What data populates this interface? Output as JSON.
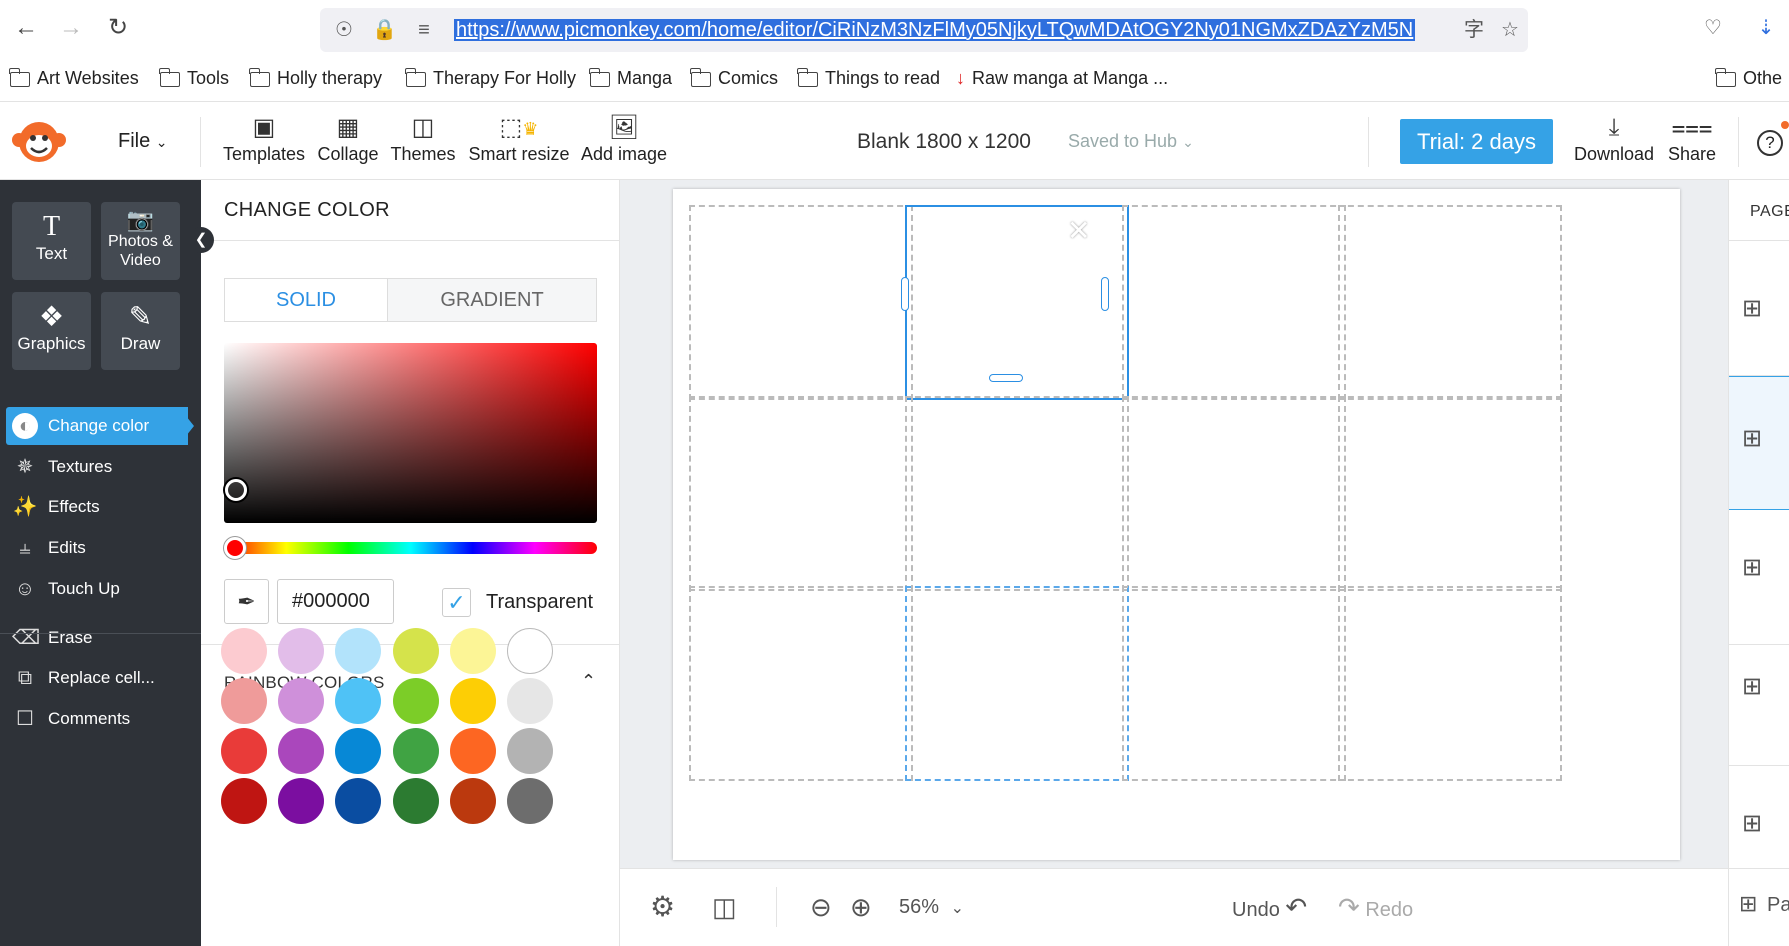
{
  "browser": {
    "url": "https://www.picmonkey.com/home/editor/CiRiNzM3NzFlMy05NjkyLTQwMDAtOGY2Ny01NGMxZDAzYzM5N",
    "bookmarks": [
      "Art Websites",
      "Tools",
      "Holly therapy",
      "Therapy For Holly",
      "Manga",
      "Comics",
      "Things to read",
      "Raw manga at Manga ...",
      "Othe"
    ]
  },
  "topbar": {
    "file_label": "File",
    "tools": [
      {
        "label": "Templates",
        "icon": "templates-icon"
      },
      {
        "label": "Collage",
        "icon": "collage-icon"
      },
      {
        "label": "Themes",
        "icon": "themes-icon"
      },
      {
        "label": "Smart resize",
        "icon": "smart-resize-icon"
      },
      {
        "label": "Add image",
        "icon": "add-image-icon"
      }
    ],
    "doc_title": "Blank 1800 x 1200",
    "saved_status": "Saved to Hub",
    "trial_label": "Trial: 2 days",
    "download_label": "Download",
    "share_label": "Share"
  },
  "sidebar": {
    "tiles": [
      {
        "label": "Text",
        "icon": "text-icon"
      },
      {
        "label": "Photos & Video",
        "icon": "camera-icon"
      },
      {
        "label": "Graphics",
        "icon": "graphics-icon"
      },
      {
        "label": "Draw",
        "icon": "draw-icon"
      }
    ],
    "items": [
      {
        "label": "Change color",
        "icon": "change-color-icon",
        "active": true
      },
      {
        "label": "Textures",
        "icon": "textures-icon"
      },
      {
        "label": "Effects",
        "icon": "effects-icon"
      },
      {
        "label": "Edits",
        "icon": "edits-icon"
      },
      {
        "label": "Touch Up",
        "icon": "touch-up-icon"
      },
      {
        "label": "Erase",
        "icon": "erase-icon"
      },
      {
        "label": "Replace cell...",
        "icon": "replace-cell-icon"
      },
      {
        "label": "Comments",
        "icon": "comments-icon"
      }
    ]
  },
  "color_panel": {
    "title": "CHANGE COLOR",
    "tab_solid": "SOLID",
    "tab_gradient": "GRADIENT",
    "active_tab": "SOLID",
    "hex_value": "#000000",
    "transparent_label": "Transparent",
    "transparent_checked": true,
    "rainbow_title": "RAINBOW COLORS",
    "swatches": [
      [
        "#fccbd0",
        "#e2bde9",
        "#b2e3fb",
        "#d5e34b",
        "#fcf596",
        "#ffffff"
      ],
      [
        "#ef9b9a",
        "#cf90da",
        "#4fc2f6",
        "#7ccd28",
        "#fdce05",
        "#e6e6e6"
      ],
      [
        "#e93b39",
        "#aa47bc",
        "#0788d6",
        "#40a343",
        "#fd6622",
        "#b3b3b3"
      ],
      [
        "#bf1512",
        "#7b0ea0",
        "#0a4da1",
        "#2c7b31",
        "#bb390e",
        "#6d6d6d"
      ]
    ]
  },
  "colors": {
    "accent": "#35a2e6",
    "sidebar": "#2e3238",
    "selection": "#2b8fe3"
  },
  "bottombar": {
    "zoom": "56%",
    "undo_label": "Undo",
    "redo_label": "Redo",
    "pages_label": "Page"
  },
  "pages_panel": {
    "title": "PAGES"
  }
}
